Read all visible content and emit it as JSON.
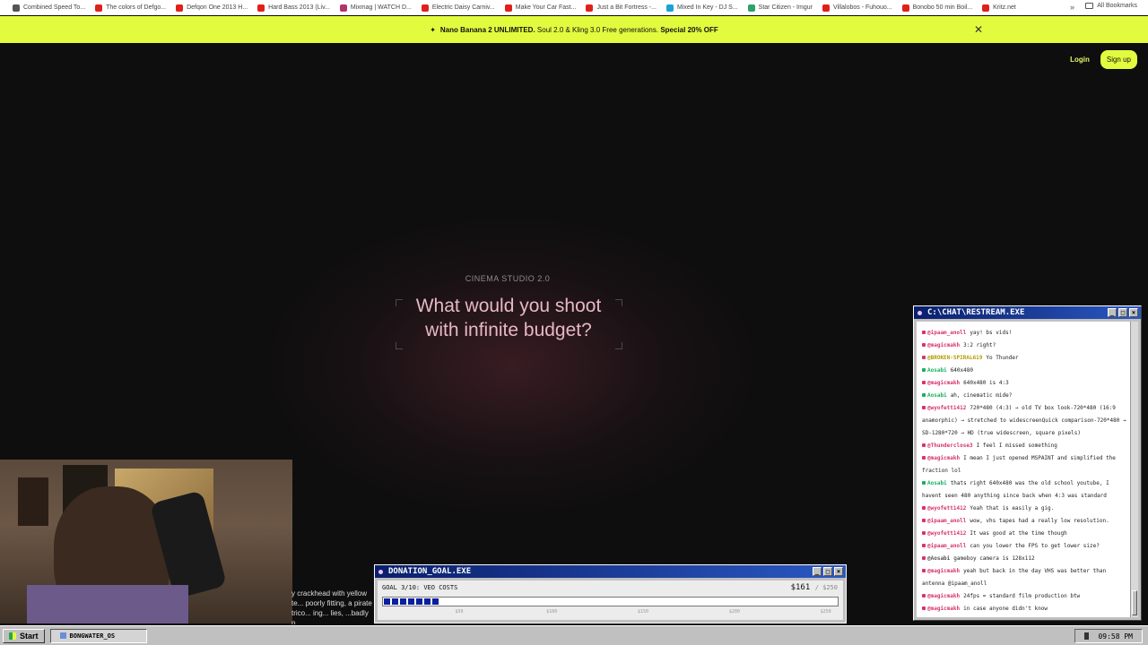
{
  "bookmarks": {
    "items": [
      {
        "label": "Combined Speed To...",
        "color": "#555555"
      },
      {
        "label": "The colors of Defgo...",
        "color": "#e0201b"
      },
      {
        "label": "Defqon One 2013 H...",
        "color": "#e0201b"
      },
      {
        "label": "Hard Bass 2013 (Liv...",
        "color": "#e0201b"
      },
      {
        "label": "Mixmag | WATCH D...",
        "color": "#b3346b"
      },
      {
        "label": "Electric Daisy Carniv...",
        "color": "#e0201b"
      },
      {
        "label": "Make Your Car Fast...",
        "color": "#e0201b"
      },
      {
        "label": "Just a Bit Fortress -...",
        "color": "#e0201b"
      },
      {
        "label": "Mixed In Key - DJ S...",
        "color": "#1aa1d6"
      },
      {
        "label": "Star Citizen - Imgur",
        "color": "#2aa36b"
      },
      {
        "label": "Villalobos - Fuhouo...",
        "color": "#e0201b"
      },
      {
        "label": "Bonobo 50 min Boil...",
        "color": "#e0201b"
      },
      {
        "label": "Kritz.net",
        "color": "#e0201b"
      }
    ],
    "more": "»",
    "all_label": "All Bookmarks"
  },
  "promo": {
    "strong": "Nano Banana 2 UNLIMITED.",
    "text": " Soul 2.0 & Kling 3.0 Free generations. ",
    "offer": "Special 20% OFF",
    "close": "✕"
  },
  "header": {
    "login": "Login",
    "signup": "Sign up"
  },
  "hero": {
    "label": "CINEMA STUDIO 2.0",
    "title": "What would you shoot with infinite budget?"
  },
  "overlap_text": "y crackhead with yellow te... poorly fitting, a pirate trico... ing... lies, ...badly p...",
  "donation": {
    "title": "DONATION_GOAL.EXE",
    "goal": "GOAL 3/10: VEO COSTS",
    "amount": "$161",
    "of": "/ $250",
    "progress": 0.64,
    "segments": 7,
    "ticks": [
      "$50",
      "$100",
      "$150",
      "$200",
      "$250"
    ]
  },
  "chat": {
    "title": "C:\\CHAT\\RESTREAM.EXE",
    "messages": [
      {
        "user": "@ipaam_anoll",
        "text": "yay! bs vids!",
        "color": "#d6336c",
        "plat": "#d6336c"
      },
      {
        "user": "@magicmakh",
        "text": "3:2 right?",
        "color": "#d6336c",
        "plat": "#d6336c"
      },
      {
        "user": "@BROKEN-SPIRAL619",
        "text": "Yo Thunder",
        "color": "#b59a00",
        "plat": "#d6336c"
      },
      {
        "user": "Aosabi",
        "text": "640x480",
        "color": "#1aaf5d",
        "plat": "#1aaf5d"
      },
      {
        "user": "@magicmakh",
        "text": "640x480 is 4:3",
        "color": "#d6336c",
        "plat": "#d6336c"
      },
      {
        "user": "Aosabi",
        "text": "ah, cinematic mide?",
        "color": "#1aaf5d",
        "plat": "#1aaf5d"
      },
      {
        "user": "@wyofett1412",
        "text": "720*480 (4:3) → old TV box look-720*480 (16:9 anamorphic) → stretched to widescreenQuick comparison-720*480 → SD-1280*720 → HD (true widescreen, square pixels)",
        "color": "#d6336c",
        "plat": "#d6336c"
      },
      {
        "user": "@Thunderclose3",
        "text": "I feel I missed something",
        "color": "#d6336c",
        "plat": "#d6336c"
      },
      {
        "user": "@magicmakh",
        "text": "I mean I just opened MSPAINT and simplified the fraction lol",
        "color": "#d6336c",
        "plat": "#d6336c"
      },
      {
        "user": "Aosabi",
        "text": "thats right 640x480 was the old school youtube, I havent seen 480 anything since back when 4:3 was standard",
        "color": "#1aaf5d",
        "plat": "#1aaf5d"
      },
      {
        "user": "@wyofett1412",
        "text": "Yeah that is easily a gig.",
        "color": "#d6336c",
        "plat": "#d6336c"
      },
      {
        "user": "@ipaam_anoll",
        "text": "wow, vhs tapes had a really low resolution.",
        "color": "#d6336c",
        "plat": "#d6336c"
      },
      {
        "user": "@wyofett1412",
        "text": "It was good at the time though",
        "color": "#d6336c",
        "plat": "#d6336c"
      },
      {
        "user": "@ipaam_anoll",
        "text": "can you lower the FPS to get lower size?",
        "color": "#d6336c",
        "plat": "#d6336c"
      },
      {
        "user": "@Aosabi",
        "text": "gameboy camera is 128x112",
        "color": "#555555",
        "plat": "#d6336c"
      },
      {
        "user": "@magicmakh",
        "text": "yeah but back in the day VHS was better than antenna @ipaam_anoll",
        "color": "#d6336c",
        "plat": "#d6336c"
      },
      {
        "user": "@magicmakh",
        "text": "24fps = standard film production btw",
        "color": "#d6336c",
        "plat": "#d6336c"
      },
      {
        "user": "@magicmakh",
        "text": "in case anyone didn't know",
        "color": "#d6336c",
        "plat": "#d6336c"
      }
    ]
  },
  "taskbar": {
    "start": "Start",
    "task": "BONGWATER_OS",
    "clock": "09:58 PM"
  },
  "colors": {
    "accent": "#e2fb3f",
    "bg": "#0e0e0e",
    "hero_text": "#e8b8c4",
    "window_title": "#0a1f6b"
  }
}
